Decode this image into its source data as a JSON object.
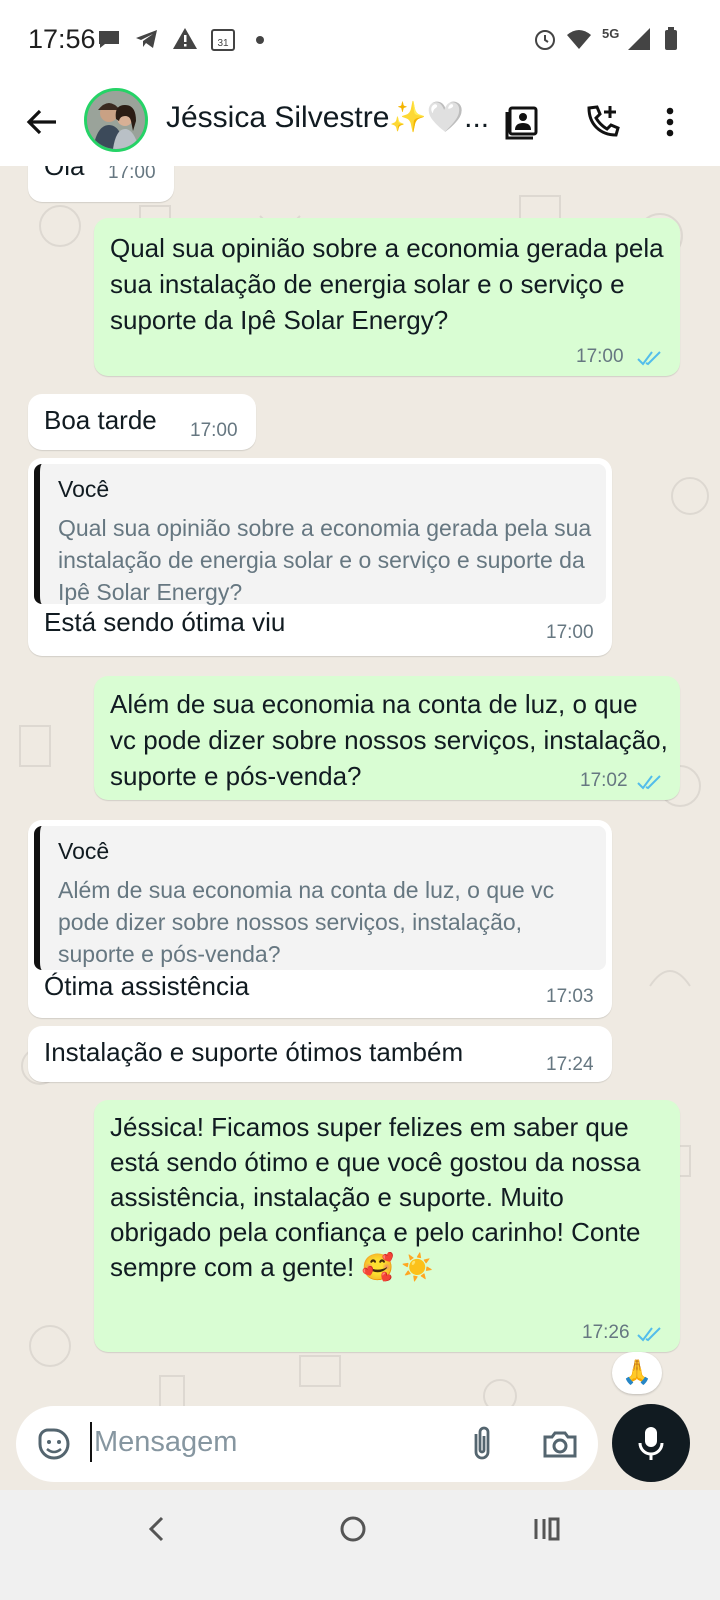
{
  "status_bar": {
    "time": "17:56",
    "network": "5G"
  },
  "header": {
    "contact_name": "Jéssica Silvestre✨🤍..."
  },
  "messages": [
    {
      "text": "Olá",
      "time": "17:00"
    },
    {
      "text": "Qual sua opinião sobre a economia gerada pela sua instalação de energia solar e o serviço e suporte da Ipê Solar Energy?",
      "time": "17:00"
    },
    {
      "text": "Boa tarde",
      "time": "17:00"
    },
    {
      "quote_author": "Você",
      "quote_text": "Qual sua opinião sobre a economia gerada pela sua instalação de energia solar e o serviço e suporte da Ipê Solar Energy?",
      "text": "Está sendo ótima viu",
      "time": "17:00"
    },
    {
      "text": "Além de sua economia na conta de luz, o que vc pode dizer sobre nossos serviços, instalação, suporte e pós-venda?",
      "time": "17:02"
    },
    {
      "quote_author": "Você",
      "quote_text": "Além de sua economia na conta de luz, o que vc pode dizer sobre nossos serviços, instalação, suporte e pós-venda?",
      "text": "Ótima assistência",
      "time": "17:03"
    },
    {
      "text": "Instalação e suporte ótimos também",
      "time": "17:24"
    },
    {
      "text": "Jéssica! Ficamos super felizes em saber que está sendo ótimo e que você gostou da nossa assistência, instalação e suporte. Muito obrigado pela confiança e pelo carinho! Conte sempre com a gente! 🥰 ☀️",
      "time": "17:26",
      "reaction": "🙏"
    }
  ],
  "composer": {
    "placeholder": "Mensagem"
  },
  "colors": {
    "outgoing": "#d9fdd3",
    "incoming": "#ffffff",
    "ticks": "#53bdeb",
    "avatar_ring": "#25d366"
  }
}
